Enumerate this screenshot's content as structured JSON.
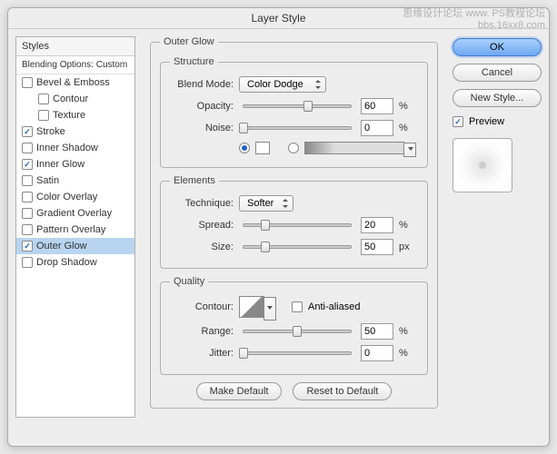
{
  "title": "Layer Style",
  "watermark": {
    "line1": "思缘设计论坛  www.",
    "line2": "PS教程论坛",
    "line3": "bbs.16xx8.com"
  },
  "sidebar": {
    "header": "Styles",
    "blend": "Blending Options: Custom",
    "items": [
      {
        "label": "Bevel & Emboss",
        "checked": false,
        "indent": false
      },
      {
        "label": "Contour",
        "checked": false,
        "indent": true
      },
      {
        "label": "Texture",
        "checked": false,
        "indent": true
      },
      {
        "label": "Stroke",
        "checked": true,
        "indent": false
      },
      {
        "label": "Inner Shadow",
        "checked": false,
        "indent": false
      },
      {
        "label": "Inner Glow",
        "checked": true,
        "indent": false
      },
      {
        "label": "Satin",
        "checked": false,
        "indent": false
      },
      {
        "label": "Color Overlay",
        "checked": false,
        "indent": false
      },
      {
        "label": "Gradient Overlay",
        "checked": false,
        "indent": false
      },
      {
        "label": "Pattern Overlay",
        "checked": false,
        "indent": false
      },
      {
        "label": "Outer Glow",
        "checked": true,
        "indent": false,
        "selected": true
      },
      {
        "label": "Drop Shadow",
        "checked": false,
        "indent": false
      }
    ]
  },
  "panel": {
    "title": "Outer Glow",
    "structure": {
      "legend": "Structure",
      "blendModeLabel": "Blend Mode:",
      "blendModeValue": "Color Dodge",
      "opacityLabel": "Opacity:",
      "opacityValue": "60",
      "noiseLabel": "Noise:",
      "noiseValue": "0",
      "percent": "%"
    },
    "elements": {
      "legend": "Elements",
      "techniqueLabel": "Technique:",
      "techniqueValue": "Softer",
      "spreadLabel": "Spread:",
      "spreadValue": "20",
      "sizeLabel": "Size:",
      "sizeValue": "50",
      "percent": "%",
      "px": "px"
    },
    "quality": {
      "legend": "Quality",
      "contourLabel": "Contour:",
      "antiAliasedLabel": "Anti-aliased",
      "rangeLabel": "Range:",
      "rangeValue": "50",
      "jitterLabel": "Jitter:",
      "jitterValue": "0",
      "percent": "%"
    },
    "buttons": {
      "makeDefault": "Make Default",
      "resetDefault": "Reset to Default"
    }
  },
  "actions": {
    "ok": "OK",
    "cancel": "Cancel",
    "newStyle": "New Style...",
    "preview": "Preview"
  }
}
